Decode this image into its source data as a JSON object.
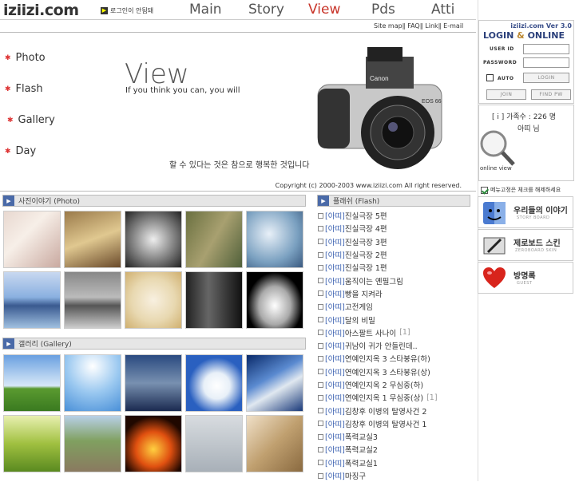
{
  "header": {
    "logo": "iziizi.com",
    "login_notice": "로그인이 안됨돼",
    "nav": [
      {
        "label": "Main",
        "active": false
      },
      {
        "label": "Story",
        "active": false
      },
      {
        "label": "View",
        "active": true
      },
      {
        "label": "Pds",
        "active": false
      },
      {
        "label": "Atti",
        "active": false
      }
    ],
    "sublinks": "Site map∥ FAQ∥ Link∥ E-mail"
  },
  "hero": {
    "menu": [
      "Photo",
      "Flash",
      "Gallery",
      "Day"
    ],
    "title": "View",
    "subtitle": "If you think you can, you will",
    "quote": "할 수 있다는 것은 참으로 행복한 것입니다",
    "copyright": "Copyright (c) 2000-2003 www.iziizi.com All right reserved."
  },
  "sections": {
    "photo": "사진이야기 (Photo)",
    "flash": "플래쉬 (Flash)",
    "gallery": "갤러리 (Gallery)"
  },
  "flash_items": [
    {
      "tag": "[아띠]",
      "title": "진실극장 5편",
      "count": ""
    },
    {
      "tag": "[아띠]",
      "title": "진실극장 4편",
      "count": ""
    },
    {
      "tag": "[아띠]",
      "title": "진실극장 3편",
      "count": ""
    },
    {
      "tag": "[아띠]",
      "title": "진실극장 2편",
      "count": ""
    },
    {
      "tag": "[아띠]",
      "title": "진실극장 1편",
      "count": ""
    },
    {
      "tag": "[아띠]",
      "title": "움직이는 옌필그림",
      "count": ""
    },
    {
      "tag": "[아띠]",
      "title": "빵을 지켜라",
      "count": ""
    },
    {
      "tag": "[아띠]",
      "title": "고전게임",
      "count": ""
    },
    {
      "tag": "[아띠]",
      "title": "달의 비밀",
      "count": ""
    },
    {
      "tag": "[아띠]",
      "title": "아스팔트 사나이",
      "count": "[1]"
    },
    {
      "tag": "[아띠]",
      "title": "귀남이 귀가 안들린데..",
      "count": ""
    },
    {
      "tag": "[아띠]",
      "title": "연예인지옥 3 스타붕유(하)",
      "count": ""
    },
    {
      "tag": "[아띠]",
      "title": "연예인지옥 3 스타붕유(상)",
      "count": ""
    },
    {
      "tag": "[아띠]",
      "title": "연예인지옥 2 무심중(하)",
      "count": ""
    },
    {
      "tag": "[아띠]",
      "title": "연예인지옥 1 무심중(상)",
      "count": "[1]"
    },
    {
      "tag": "[아띠]",
      "title": "김창후 이병의 탈영사건 2",
      "count": ""
    },
    {
      "tag": "[아띠]",
      "title": "김창후 이병의 탈영사건 1",
      "count": ""
    },
    {
      "tag": "[아띠]",
      "title": "폭력교실3",
      "count": ""
    },
    {
      "tag": "[아띠]",
      "title": "폭력교실2",
      "count": ""
    },
    {
      "tag": "[아띠]",
      "title": "폭력교실1",
      "count": ""
    },
    {
      "tag": "[아띠]",
      "title": "마징구",
      "count": ""
    }
  ],
  "login": {
    "version": "iziizi.com Ver 3.0",
    "title_a": "LOGIN",
    "title_amp": "&",
    "title_b": "ONLINE",
    "user_id_label": "USER ID",
    "password_label": "PASSWORD",
    "auto_label": "AUTO",
    "login_button": "LOGIN",
    "join_button": "JOIN",
    "find_button": "FIND PW"
  },
  "members": {
    "count_text": "[ i ] 가족수 : 226 명",
    "user_text": "아띠 님",
    "view_label": "online view"
  },
  "menu_fix": "메뉴고정은 체크를 해제하세요",
  "boards": [
    {
      "title": "우리들의 이야기",
      "sub": "STORY BOARD",
      "icon": "finder-icon"
    },
    {
      "title": "제로보드 스킨",
      "sub": "ZEROBOARD SKIN",
      "icon": "pen-icon"
    },
    {
      "title": "방명록",
      "sub": "GUEST",
      "icon": "heart-icon"
    }
  ],
  "colors": {
    "accent_red": "#c8352a",
    "header_blue": "#4a6aa8",
    "tag_blue": "#3a60b0"
  }
}
